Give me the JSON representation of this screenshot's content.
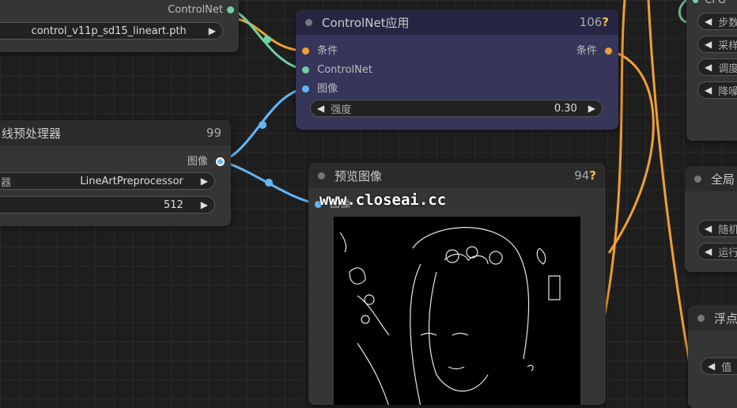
{
  "colors": {
    "conditioning": "#f0a030",
    "controlnet": "#6fd0a3",
    "image": "#64b5f6",
    "accent_question": "#f5c242"
  },
  "node_loader": {
    "output_label": "ControlNet",
    "model_value": "control_v11p_sd15_lineart.pth"
  },
  "node_apply": {
    "title": "ControlNet应用",
    "id": "106",
    "q": "?",
    "inputs": [
      "条件",
      "ControlNet",
      "图像"
    ],
    "output": "条件",
    "strength_label": "强度",
    "strength_value": "0.30"
  },
  "node_preprocessor": {
    "title": "线预处理器",
    "id": "99",
    "output": "图像",
    "widget1_label": "器",
    "widget1_value": "LineArtPreprocessor",
    "widget2_value": "512"
  },
  "node_preview": {
    "title": "预览图像",
    "id": "94",
    "q": "?",
    "input": "图像",
    "watermark": "www.closeai.cc"
  },
  "node_sampler": {
    "top_label": "CFG",
    "widgets": [
      "步数",
      "采样",
      "调度",
      "降噪"
    ]
  },
  "node_global": {
    "title": "全局",
    "widgets": [
      "随机",
      "运行"
    ]
  },
  "node_float": {
    "title": "浮点",
    "widget": "值"
  }
}
